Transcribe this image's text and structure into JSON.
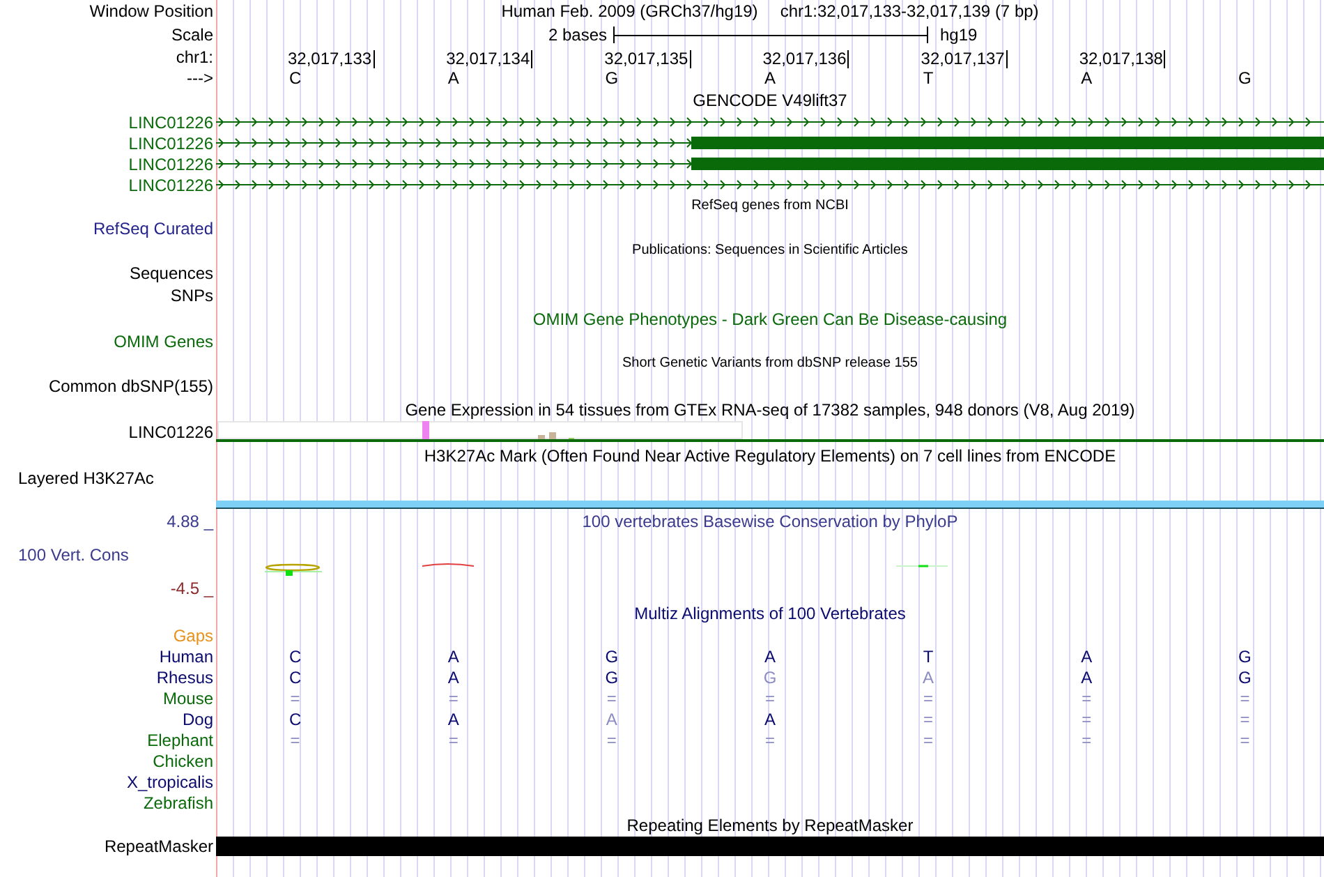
{
  "rows": [
    {
      "kind": "position",
      "label": "Window Position",
      "assembly": "Human Feb. 2009 (GRCh37/hg19)",
      "range": "chr1:32,017,133-32,017,139 (7 bp)"
    },
    {
      "kind": "scale",
      "label": "Scale",
      "text": "2 bases",
      "db": "hg19"
    },
    {
      "kind": "coordinates",
      "label": "chr1:",
      "positions": [
        "32,017,133",
        "32,017,134",
        "32,017,135",
        "32,017,136",
        "32,017,137",
        "32,017,138"
      ]
    },
    {
      "kind": "sequence",
      "label": "--->",
      "bases": [
        "C",
        "A",
        "G",
        "A",
        "T",
        "A",
        "G"
      ]
    },
    {
      "kind": "title",
      "text": "GENCODE V49lift37",
      "color": "#000000"
    },
    {
      "kind": "gene",
      "label": "LINC01226",
      "color": "#0a6a0a",
      "thick": false
    },
    {
      "kind": "gene",
      "label": "LINC01226",
      "color": "#0a6a0a",
      "thick": true
    },
    {
      "kind": "gene",
      "label": "LINC01226",
      "color": "#0a6a0a",
      "thick": true
    },
    {
      "kind": "gene",
      "label": "LINC01226",
      "color": "#0a6a0a",
      "thick": false
    },
    {
      "kind": "caption",
      "text": "RefSeq genes from NCBI"
    },
    {
      "kind": "label",
      "label": "RefSeq Curated",
      "color": "#24248c"
    },
    {
      "kind": "caption",
      "text": "Publications: Sequences in Scientific Articles"
    },
    {
      "kind": "label",
      "label": "Sequences",
      "color": "#000000"
    },
    {
      "kind": "label",
      "label": "SNPs",
      "color": "#000000"
    },
    {
      "kind": "title",
      "text": "OMIM Gene Phenotypes - Dark Green Can Be Disease-causing",
      "color": "#0a6a0a"
    },
    {
      "kind": "label",
      "label": "OMIM Genes",
      "color": "#0a6a0a"
    },
    {
      "kind": "caption",
      "text": "Short Genetic Variants from dbSNP release 155"
    },
    {
      "kind": "label",
      "label": "Common dbSNP(155)",
      "color": "#000000"
    },
    {
      "kind": "title",
      "text": "Gene Expression in 54 tissues from GTEx RNA-seq of 17382 samples, 948 donors (V8, Aug 2019)",
      "color": "#000000"
    },
    {
      "kind": "expression",
      "label": "LINC01226",
      "color": "#000000"
    },
    {
      "kind": "title",
      "text": "H3K27Ac Mark (Often Found Near Active Regulatory Elements) on 7 cell lines from ENCODE",
      "color": "#000000"
    },
    {
      "kind": "side_label",
      "label": "Layered H3K27Ac",
      "color": "#000000"
    },
    {
      "kind": "signal"
    },
    {
      "kind": "axis",
      "label": "4.88 _",
      "text": "100 vertebrates Basewise Conservation by PhyloP",
      "color": "#3a3a8e"
    },
    {
      "kind": "wiggle",
      "label": "100 Vert. Cons",
      "color": "#3a3a8e"
    },
    {
      "kind": "axis",
      "label": "-4.5 _",
      "color": "#8b2c2c"
    },
    {
      "kind": "title",
      "text": "Multiz Alignments of 100 Vertebrates",
      "color": "#0b0b6f"
    },
    {
      "kind": "species",
      "label": "Gaps",
      "color": "#e8901a",
      "bases": []
    },
    {
      "kind": "species",
      "label": "Human",
      "color": "#0b0b6f",
      "bases": [
        {
          "text": "C",
          "faded": false
        },
        {
          "text": "A",
          "faded": false
        },
        {
          "text": "G",
          "faded": false
        },
        {
          "text": "A",
          "faded": false
        },
        {
          "text": "T",
          "faded": false
        },
        {
          "text": "A",
          "faded": false
        },
        {
          "text": "G",
          "faded": false
        }
      ]
    },
    {
      "kind": "species",
      "label": "Rhesus",
      "color": "#0b0b6f",
      "bases": [
        {
          "text": "C",
          "faded": false
        },
        {
          "text": "A",
          "faded": false
        },
        {
          "text": "G",
          "faded": false
        },
        {
          "text": "G",
          "faded": true
        },
        {
          "text": "A",
          "faded": true
        },
        {
          "text": "A",
          "faded": false
        },
        {
          "text": "G",
          "faded": false
        }
      ]
    },
    {
      "kind": "species",
      "label": "Mouse",
      "color": "#0a6a0a",
      "bases": [
        {
          "text": "=",
          "faded": true
        },
        {
          "text": "=",
          "faded": true
        },
        {
          "text": "=",
          "faded": true
        },
        {
          "text": "=",
          "faded": true
        },
        {
          "text": "=",
          "faded": true
        },
        {
          "text": "=",
          "faded": true
        },
        {
          "text": "=",
          "faded": true
        }
      ]
    },
    {
      "kind": "species",
      "label": "Dog",
      "color": "#0b0b6f",
      "bases": [
        {
          "text": "C",
          "faded": false
        },
        {
          "text": "A",
          "faded": false
        },
        {
          "text": "A",
          "faded": true
        },
        {
          "text": "A",
          "faded": false
        },
        {
          "text": "=",
          "faded": true
        },
        {
          "text": "=",
          "faded": true
        },
        {
          "text": "=",
          "faded": true
        }
      ]
    },
    {
      "kind": "species",
      "label": "Elephant",
      "color": "#0a6a0a",
      "bases": [
        {
          "text": "=",
          "faded": true
        },
        {
          "text": "=",
          "faded": true
        },
        {
          "text": "=",
          "faded": true
        },
        {
          "text": "=",
          "faded": true
        },
        {
          "text": "=",
          "faded": true
        },
        {
          "text": "=",
          "faded": true
        },
        {
          "text": "=",
          "faded": true
        }
      ]
    },
    {
      "kind": "species",
      "label": "Chicken",
      "color": "#0a6a0a",
      "bases": []
    },
    {
      "kind": "species",
      "label": "X_tropicalis",
      "color": "#0b0b6f",
      "bases": []
    },
    {
      "kind": "species",
      "label": "Zebrafish",
      "color": "#0a6a0a",
      "bases": []
    },
    {
      "kind": "title",
      "text": "Repeating Elements by RepeatMasker",
      "color": "#000000"
    },
    {
      "kind": "repeat",
      "label": "RepeatMasker",
      "color": "#000000"
    }
  ]
}
